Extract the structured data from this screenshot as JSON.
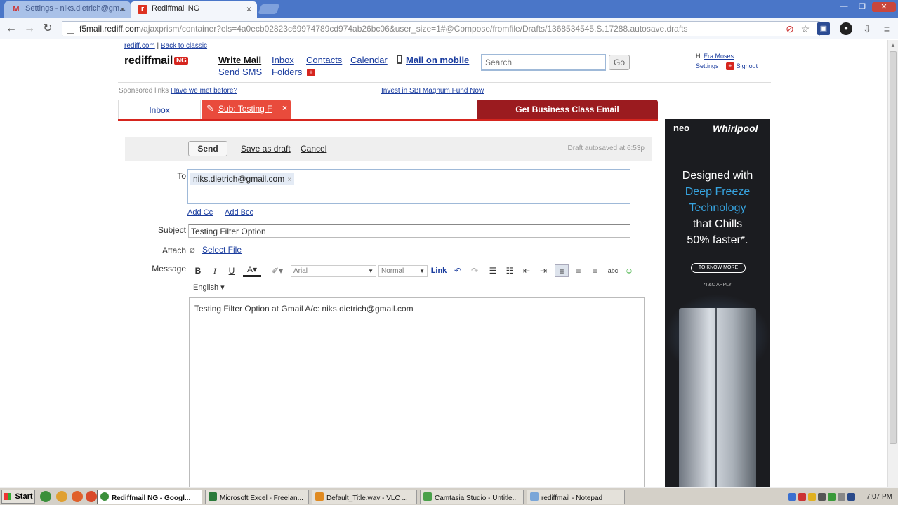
{
  "browser": {
    "tabs": [
      {
        "title": "Settings - niks.dietrich@gm..."
      },
      {
        "title": "Rediffmail NG"
      }
    ],
    "url_host": "f5mail.rediff.com",
    "url_path": "/ajaxprism/container?els=4a0ecb02823c69974789cd974ab26bc06&user_size=1#@Compose/fromfile/Drafts/1368534545.S.17288.autosave.drafts"
  },
  "header": {
    "rediff_link": "rediff.com",
    "separator": "|",
    "classic_link": "Back to classic",
    "logo_text": "rediffmail",
    "logo_badge": "NG",
    "nav": {
      "write": "Write Mail",
      "inbox": "Inbox",
      "contacts": "Contacts",
      "calendar": "Calendar",
      "mobile": "Mail on mobile",
      "sms": "Send SMS",
      "folders": "Folders"
    },
    "search_placeholder": "Search",
    "go_label": "Go",
    "greeting": "Hi",
    "user_name": "Era Moses",
    "settings": "Settings",
    "signout": "Signout"
  },
  "sponsored": {
    "label": "Sponsored links",
    "ad1": "Have we met before?",
    "ad2": "Invest in SBI Magnum Fund Now"
  },
  "tabs": {
    "inbox": "Inbox",
    "compose": "Sub: Testing F",
    "business": "Get Business Class Email"
  },
  "compose": {
    "send": "Send",
    "save_draft": "Save as draft",
    "cancel": "Cancel",
    "autosave": "Draft autosaved at 6:53p",
    "to_label": "To",
    "to_recipient": "niks.dietrich@gmail.com",
    "add_cc": "Add Cc",
    "add_bcc": "Add Bcc",
    "subject_label": "Subject",
    "subject_value": "Testing Filter Option",
    "attach_label": "Attach",
    "select_file": "Select File",
    "message_label": "Message",
    "font_value": "Arial",
    "size_value": "Normal",
    "link_label": "Link",
    "language": "English",
    "body_part1": "Testing Filter Option at ",
    "body_gmail": "Gmail",
    "body_part2": " A/c: ",
    "body_email": "niks.dietrich@gmail.com"
  },
  "ad": {
    "neo": "neo",
    "whirlpool": "Whirlpool",
    "line1": "Designed with",
    "line2": "Deep Freeze",
    "line3": "Technology",
    "line4": "that Chills",
    "line5": "50% faster*.",
    "cta": "TO KNOW MORE",
    "tc": "*T&C APPLY"
  },
  "taskbar": {
    "start": "Start",
    "tasks": [
      {
        "label": "Rediffmail NG - Googl..."
      },
      {
        "label": "Microsoft Excel - Freelan..."
      },
      {
        "label": "Default_Title.wav - VLC ..."
      },
      {
        "label": "Camtasia Studio - Untitle..."
      },
      {
        "label": "rediffmail - Notepad"
      }
    ],
    "clock": "7:07 PM"
  }
}
